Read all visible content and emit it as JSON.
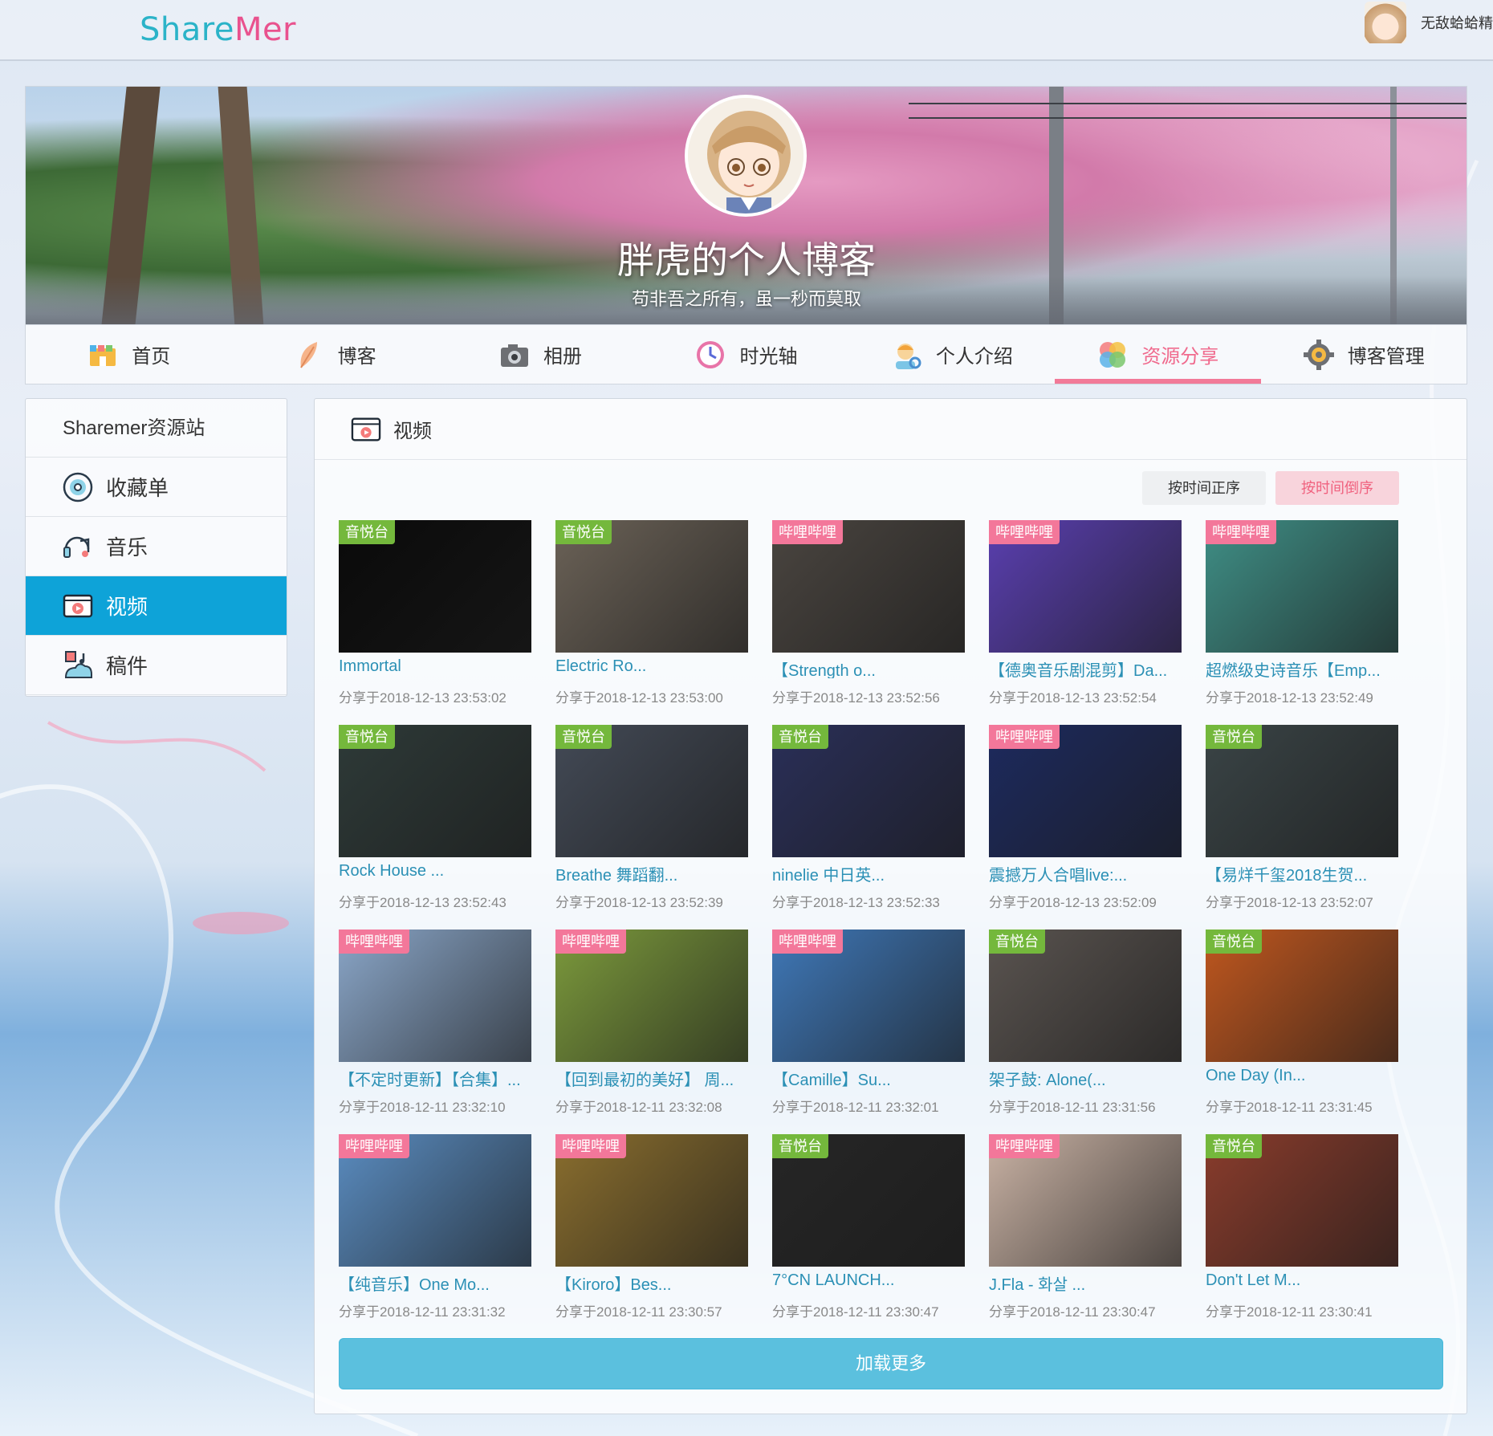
{
  "brand": {
    "logo_part1": "Share",
    "logo_part2": "Mer"
  },
  "user": {
    "name": "无敌蛤蛤精"
  },
  "banner": {
    "title": "胖虎的个人博客",
    "subtitle": "苟非吾之所有，虽一秒而莫取"
  },
  "nav": {
    "items": [
      {
        "label": "首页",
        "icon": "home-icon"
      },
      {
        "label": "博客",
        "icon": "feather-icon"
      },
      {
        "label": "相册",
        "icon": "camera-icon"
      },
      {
        "label": "时光轴",
        "icon": "clock-icon"
      },
      {
        "label": "个人介绍",
        "icon": "profile-icon"
      },
      {
        "label": "资源分享",
        "icon": "share-icon",
        "active": true
      },
      {
        "label": "博客管理",
        "icon": "gear-icon"
      }
    ]
  },
  "sidebar": {
    "title": "Sharemer资源站",
    "items": [
      {
        "label": "收藏单",
        "icon": "disc-icon"
      },
      {
        "label": "音乐",
        "icon": "music-icon"
      },
      {
        "label": "视频",
        "icon": "video-icon",
        "active": true
      },
      {
        "label": "稿件",
        "icon": "manuscript-icon"
      }
    ]
  },
  "main": {
    "section_title": "视频",
    "sort_asc": "按时间正序",
    "sort_desc": "按时间倒序",
    "load_more": "加载更多"
  },
  "colors": {
    "accent_pink": "#f27a98",
    "sidebar_active": "#0ea3d8",
    "badge_yinyuetai": "#74b83c",
    "badge_bilibili": "#f3779a",
    "link_blue": "#2b90b5",
    "load_more": "#5bc0de"
  },
  "videos": [
    {
      "badge": "音悦台",
      "src": "yyt",
      "title": "Immortal",
      "date": "分享于2018-12-13 23:53:02",
      "thumb": "#0a0a0a"
    },
    {
      "badge": "音悦台",
      "src": "yyt",
      "title": "Electric Ro...",
      "date": "分享于2018-12-13 23:53:00",
      "thumb": "#6b6257"
    },
    {
      "badge": "哔哩哔哩",
      "src": "bili",
      "title": "【Strength o...",
      "date": "分享于2018-12-13 23:52:56",
      "thumb": "#4a4540"
    },
    {
      "badge": "哔哩哔哩",
      "src": "bili",
      "title": "【德奥音乐剧混剪】Da...",
      "date": "分享于2018-12-13 23:52:54",
      "thumb": "#5a3fb0"
    },
    {
      "badge": "哔哩哔哩",
      "src": "bili",
      "title": "超燃级史诗音乐【Emp...",
      "date": "分享于2018-12-13 23:52:49",
      "thumb": "#3f8f86"
    },
    {
      "badge": "音悦台",
      "src": "yyt",
      "title": "Rock House ...",
      "date": "分享于2018-12-13 23:52:43",
      "thumb": "#2e3a38"
    },
    {
      "badge": "音悦台",
      "src": "yyt",
      "title": "Breathe 舞蹈翻...",
      "date": "分享于2018-12-13 23:52:39",
      "thumb": "#434a56"
    },
    {
      "badge": "音悦台",
      "src": "yyt",
      "title": "ninelie 中日英...",
      "date": "分享于2018-12-13 23:52:33",
      "thumb": "#2a2f58"
    },
    {
      "badge": "哔哩哔哩",
      "src": "bili",
      "title": "震撼万人合唱live:...",
      "date": "分享于2018-12-13 23:52:09",
      "thumb": "#1d2a5e"
    },
    {
      "badge": "音悦台",
      "src": "yyt",
      "title": "【易烊千玺2018生贺...",
      "date": "分享于2018-12-13 23:52:07",
      "thumb": "#3a4446"
    },
    {
      "badge": "哔哩哔哩",
      "src": "bili",
      "title": "【不定时更新】【合集】...",
      "date": "分享于2018-12-11 23:32:10",
      "thumb": "#8aa6c8"
    },
    {
      "badge": "哔哩哔哩",
      "src": "bili",
      "title": "【回到最初的美好】 周...",
      "date": "分享于2018-12-11 23:32:08",
      "thumb": "#7c9a3c"
    },
    {
      "badge": "哔哩哔哩",
      "src": "bili",
      "title": "【Camille】Su...",
      "date": "分享于2018-12-11 23:32:01",
      "thumb": "#3f78b8"
    },
    {
      "badge": "音悦台",
      "src": "yyt",
      "title": "架子鼓: Alone(...",
      "date": "分享于2018-12-11 23:31:56",
      "thumb": "#5a5450"
    },
    {
      "badge": "音悦台",
      "src": "yyt",
      "title": "One Day (In...",
      "date": "分享于2018-12-11 23:31:45",
      "thumb": "#c0571f"
    },
    {
      "badge": "哔哩哔哩",
      "src": "bili",
      "title": "【纯音乐】One Mo...",
      "date": "分享于2018-12-11 23:31:32",
      "thumb": "#5a8cc0"
    },
    {
      "badge": "哔哩哔哩",
      "src": "bili",
      "title": "【Kiroro】Bes...",
      "date": "分享于2018-12-11 23:30:57",
      "thumb": "#8a6e2e"
    },
    {
      "badge": "音悦台",
      "src": "yyt",
      "title": "7°CN LAUNCH...",
      "date": "分享于2018-12-11 23:30:47",
      "thumb": "#262626"
    },
    {
      "badge": "哔哩哔哩",
      "src": "bili",
      "title": "J.Fla - 화살 ...",
      "date": "分享于2018-12-11 23:30:47",
      "thumb": "#c9b2a4"
    },
    {
      "badge": "音悦台",
      "src": "yyt",
      "title": "Don't Let M...",
      "date": "分享于2018-12-11 23:30:41",
      "thumb": "#8a3c2c"
    }
  ]
}
